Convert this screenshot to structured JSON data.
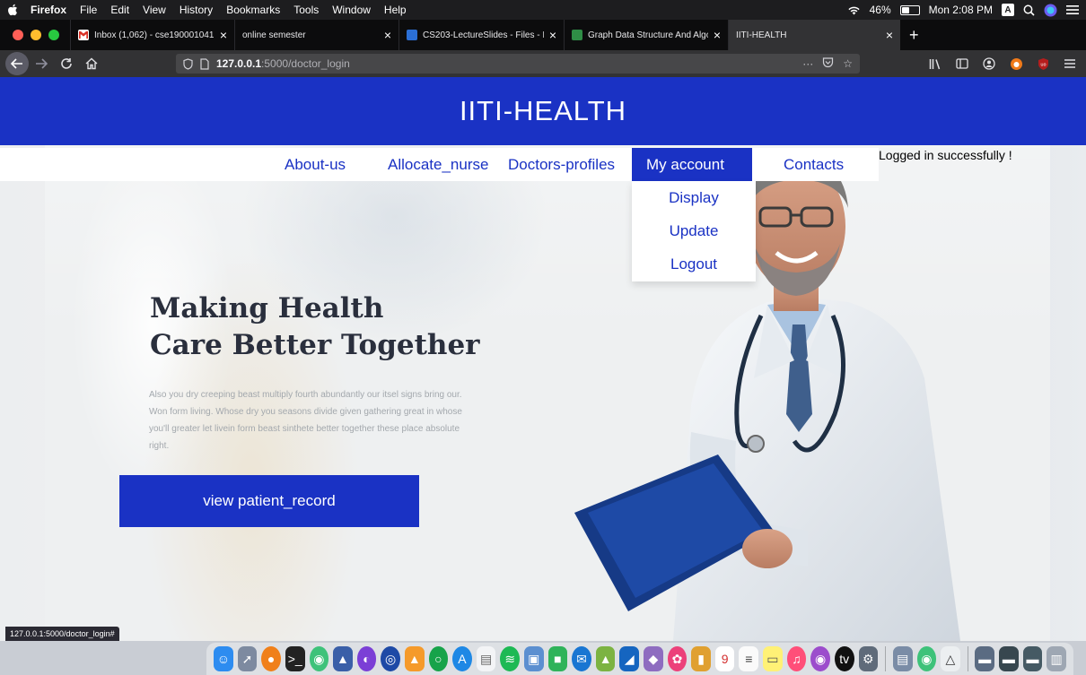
{
  "menubar": {
    "app_name": "Firefox",
    "menus": [
      "File",
      "Edit",
      "View",
      "History",
      "Bookmarks",
      "Tools",
      "Window",
      "Help"
    ],
    "battery_percent": "46%",
    "battery_level": 0.46,
    "clock": "Mon 2:08 PM",
    "input_source": "A"
  },
  "tabs": [
    {
      "title": "Inbox (1,062) - cse190001041",
      "favicon": "gmail-icon",
      "color": "#d93025",
      "active": false
    },
    {
      "title": "online semester",
      "favicon": "",
      "color": "",
      "active": false
    },
    {
      "title": "CS203-LectureSlides - Files - I",
      "favicon": "files-icon",
      "color": "#2b6fd6",
      "active": false
    },
    {
      "title": "Graph Data Structure And Algo",
      "favicon": "gfg-icon",
      "color": "#2f8d46",
      "active": false
    },
    {
      "title": "IITI-HEALTH",
      "favicon": "",
      "color": "",
      "active": true
    }
  ],
  "address": {
    "host": "127.0.0.1",
    "path": ":5000/doctor_login"
  },
  "site": {
    "title": "IITI-HEALTH",
    "brand_color": "#1a32c4",
    "nav": [
      "About-us",
      "Allocate_nurse",
      "Doctors-profiles",
      "My account",
      "Contacts"
    ],
    "dropdown": [
      "Display",
      "Update",
      "Logout"
    ],
    "flash_message": "Logged in successfully !",
    "headline_line1": "Making Health",
    "headline_line2": "Care Better Together",
    "blurb": "Also you dry creeping beast multiply fourth abundantly our itsel signs bring our. Won form living. Whose dry you seasons divide given gathering great in whose you'll greater let livein form beast sinthete better together these place absolute right.",
    "cta": "view patient_record"
  },
  "status_bar_url": "127.0.0.1:5000/doctor_login#"
}
